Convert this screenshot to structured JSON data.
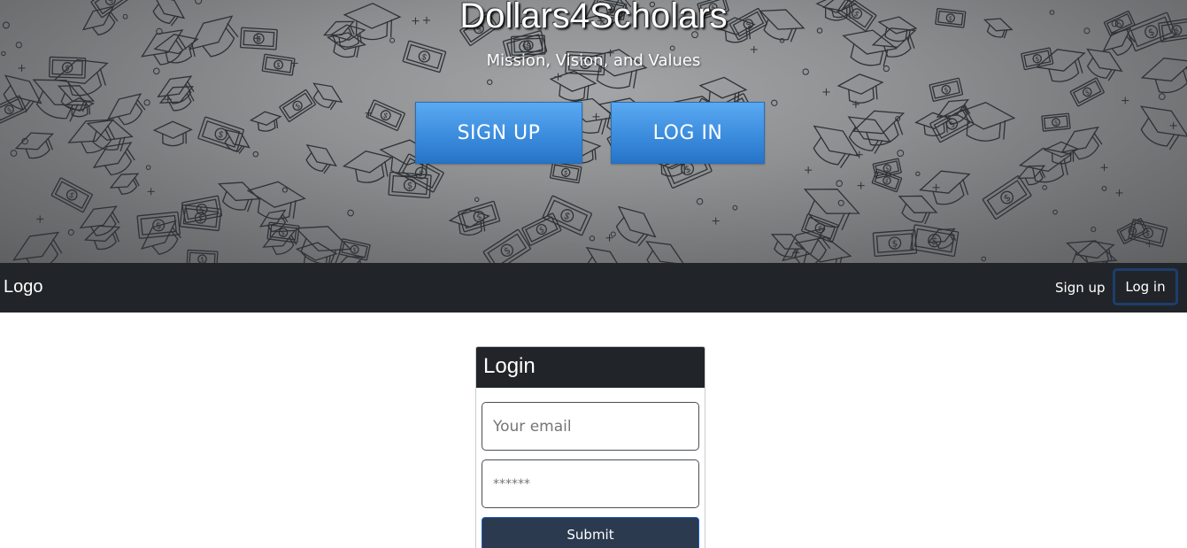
{
  "hero": {
    "title": "Dollars4Scholars",
    "subtitle": "Mission, Vision, and Values",
    "signup_label": "SIGN UP",
    "login_label": "LOG IN",
    "pattern_icons": [
      "graduation-cap-icon",
      "dollar-bill-icon"
    ]
  },
  "navbar": {
    "brand": "Logo",
    "signup_link": "Sign up",
    "login_link": "Log in"
  },
  "login_card": {
    "title": "Login",
    "email_placeholder": "Your email",
    "password_placeholder": "******",
    "submit_label": "Submit"
  },
  "colors": {
    "navbar_bg": "#212529",
    "hero_button": "#3f8fe0",
    "submit_bg": "#2b3a4f"
  }
}
